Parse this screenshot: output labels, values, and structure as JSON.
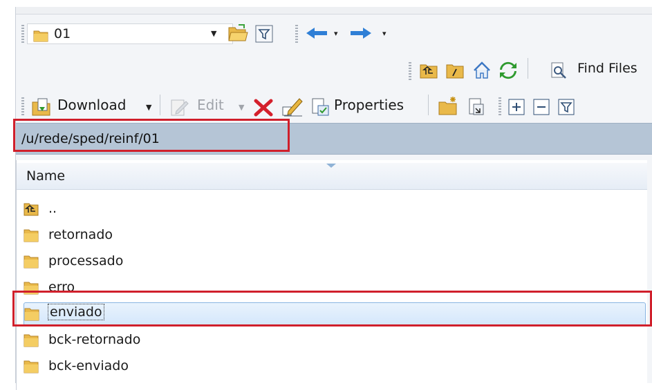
{
  "directory_combo": {
    "value": "01",
    "icon": "folder-icon"
  },
  "toolbar_top": {
    "icons": [
      "open-folder-icon",
      "filter-icon",
      "back-arrow-icon",
      "forward-arrow-icon"
    ]
  },
  "toolbar_nav": {
    "icons": [
      "parent-folder-icon",
      "root-folder-icon",
      "home-icon",
      "refresh-icon",
      "find-files-icon"
    ],
    "find_files_label": "Find Files"
  },
  "toolbar_actions": {
    "download_label": "Download",
    "edit_label": "Edit",
    "properties_label": "Properties",
    "icons": [
      "download-icon",
      "edit-icon",
      "delete-icon",
      "rename-icon",
      "properties-icon",
      "new-folder-icon",
      "new-file-icon",
      "expand-icon",
      "collapse-icon",
      "filter-icon"
    ]
  },
  "path": {
    "value": "/u/rede/sped/reinf/01"
  },
  "file_list": {
    "column_name": "Name",
    "items": [
      {
        "label": "..",
        "icon": "parent-folder-icon"
      },
      {
        "label": "retornado",
        "icon": "folder-icon"
      },
      {
        "label": "processado",
        "icon": "folder-icon"
      },
      {
        "label": "erro",
        "icon": "folder-icon"
      },
      {
        "label": "enviado",
        "icon": "folder-icon",
        "selected": true
      },
      {
        "label": "bck-retornado",
        "icon": "folder-icon"
      },
      {
        "label": "bck-enviado",
        "icon": "folder-icon"
      }
    ]
  },
  "colors": {
    "highlight_red": "#d01f2b",
    "path_bar": "#b5c5d6",
    "selection": "#d4e7fb"
  }
}
